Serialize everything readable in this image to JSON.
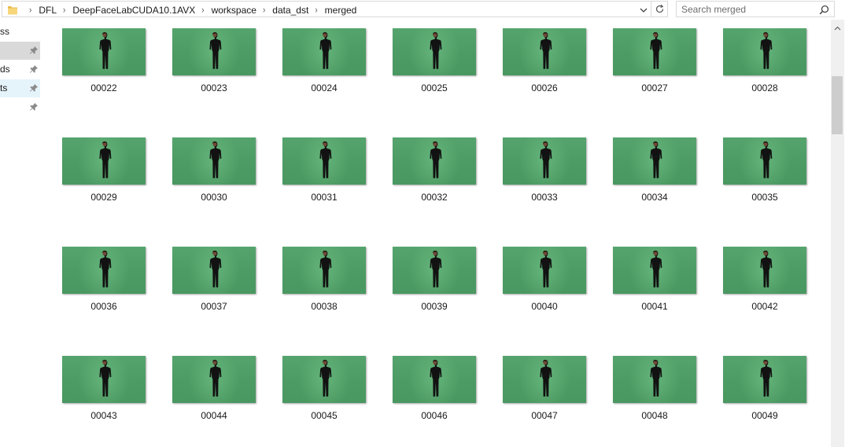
{
  "address_bar": {
    "breadcrumbs": [
      "DFL",
      "DeepFaceLabCUDA10.1AVX",
      "workspace",
      "data_dst",
      "merged"
    ]
  },
  "search": {
    "placeholder": "Search merged"
  },
  "nav_pane": {
    "items": [
      {
        "label": "ss",
        "pinned": false,
        "state": "normal"
      },
      {
        "label": "",
        "pinned": true,
        "state": "selected"
      },
      {
        "label": "ds",
        "pinned": true,
        "state": "normal"
      },
      {
        "label": "ts",
        "pinned": true,
        "state": "hover"
      },
      {
        "label": "",
        "pinned": true,
        "state": "normal"
      }
    ]
  },
  "files": [
    {
      "name": "00022"
    },
    {
      "name": "00023"
    },
    {
      "name": "00024"
    },
    {
      "name": "00025"
    },
    {
      "name": "00026"
    },
    {
      "name": "00027"
    },
    {
      "name": "00028"
    },
    {
      "name": "00029"
    },
    {
      "name": "00030"
    },
    {
      "name": "00031"
    },
    {
      "name": "00032"
    },
    {
      "name": "00033"
    },
    {
      "name": "00034"
    },
    {
      "name": "00035"
    },
    {
      "name": "00036"
    },
    {
      "name": "00037"
    },
    {
      "name": "00038"
    },
    {
      "name": "00039"
    },
    {
      "name": "00040"
    },
    {
      "name": "00041"
    },
    {
      "name": "00042"
    },
    {
      "name": "00043"
    },
    {
      "name": "00044"
    },
    {
      "name": "00045"
    },
    {
      "name": "00046"
    },
    {
      "name": "00047"
    },
    {
      "name": "00048"
    },
    {
      "name": "00049"
    }
  ],
  "colors": {
    "green_screen": "#4c9b64",
    "selected_nav": "#d9d9d9",
    "hover_nav": "#e5f3fb"
  },
  "icons": {
    "folder": "folder-icon",
    "separator": "chevron-right-icon",
    "dropdown": "chevron-down-icon",
    "refresh": "refresh-icon",
    "search": "search-icon",
    "pin": "pin-icon"
  }
}
